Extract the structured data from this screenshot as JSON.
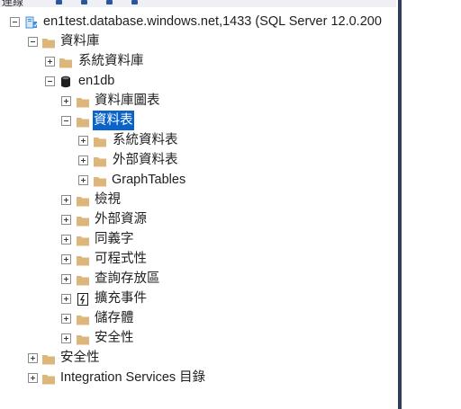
{
  "toolbar": {
    "label": "連線"
  },
  "tree": {
    "server": "en1test.database.windows.net,1433 (SQL Server 12.0.200",
    "databases": "資料庫",
    "system_databases": "系統資料庫",
    "db": "en1db",
    "db_diagrams": "資料庫圖表",
    "tables": "資料表",
    "system_tables": "系統資料表",
    "external_tables": "外部資料表",
    "graph_tables": "GraphTables",
    "views": "檢視",
    "external_resources": "外部資源",
    "synonyms": "同義字",
    "programmability": "可程式性",
    "query_store": "查詢存放區",
    "extended_events": "擴充事件",
    "storage": "儲存體",
    "db_security": "安全性",
    "security": "安全性",
    "integration_services": "Integration Services 目錄"
  },
  "colors": {
    "folder": "#dcb67a",
    "selection": "#0a63c9",
    "server_icon": "#3c8fdc",
    "database_icon": "#1e1e1e"
  }
}
